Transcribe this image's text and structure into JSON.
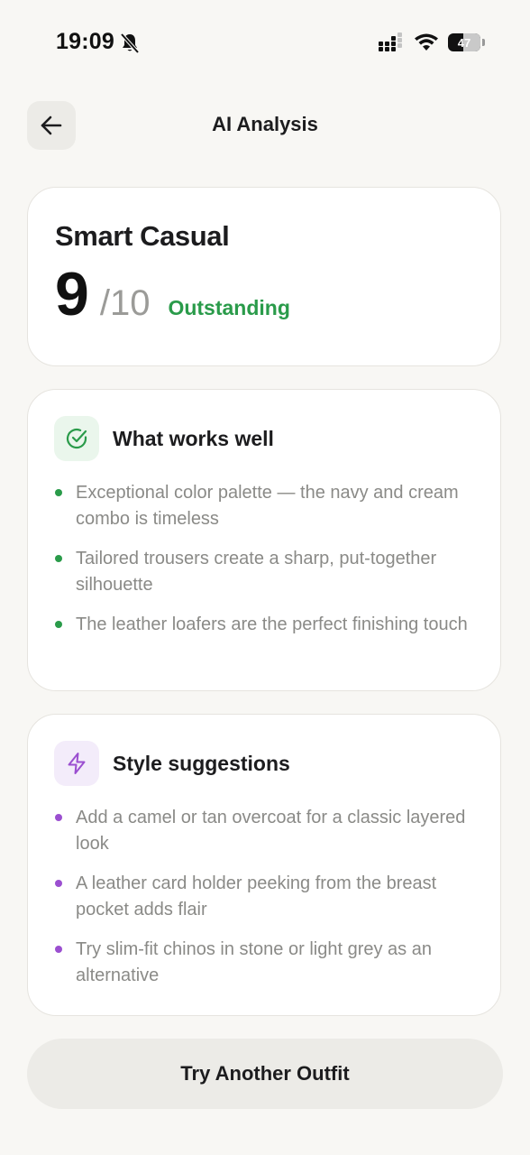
{
  "status_bar": {
    "time": "19:09",
    "battery": "47",
    "icons": [
      "bell-slash-icon",
      "signal-icon",
      "wifi-icon",
      "battery-icon"
    ]
  },
  "header": {
    "title": "AI Analysis",
    "back_icon": "arrow-left-icon"
  },
  "score_card": {
    "style_name": "Smart Casual",
    "score": "9",
    "score_max": "/10",
    "rating": "Outstanding"
  },
  "works_well": {
    "title": "What works well",
    "icon": "check-circle-icon",
    "items": [
      "Exceptional color palette — the navy and cream combo is timeless",
      "Tailored trousers create a sharp, put-together silhouette",
      "The leather loafers are the perfect finishing touch"
    ]
  },
  "suggestions": {
    "title": "Style suggestions",
    "icon": "lightning-bolt-icon",
    "items": [
      "Add a camel or tan overcoat for a classic layered look",
      "A leather card holder peeking from the breast pocket adds flair",
      "Try slim-fit chinos in stone or light grey as an alternative"
    ]
  },
  "action": {
    "label": "Try Another Outfit"
  },
  "colors": {
    "accent_green": "#2a9b4a",
    "accent_purple": "#9b4fd0",
    "background": "#f8f7f4",
    "card": "#ffffff"
  }
}
